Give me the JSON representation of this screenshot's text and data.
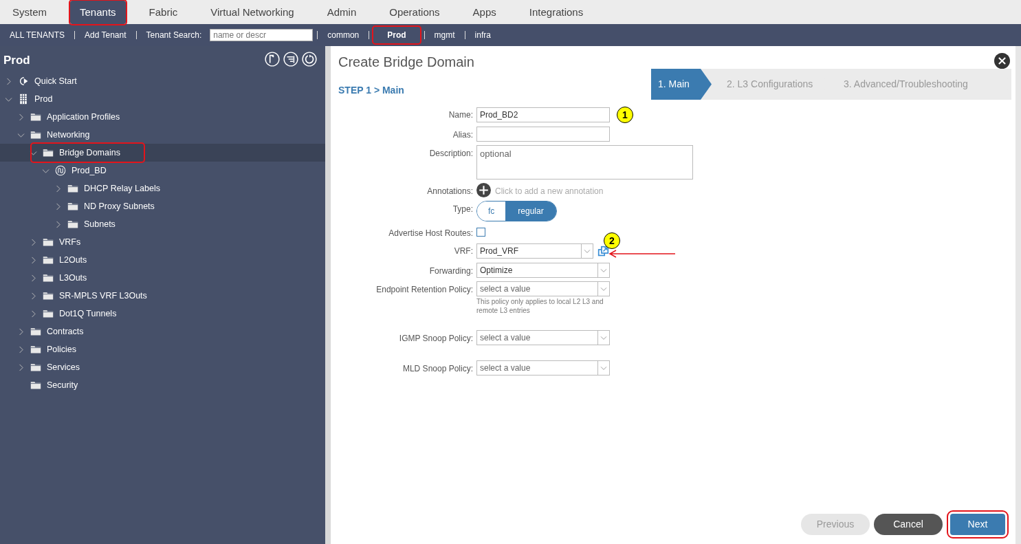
{
  "top_tabs": [
    {
      "label": "System",
      "selected": false,
      "highlighted": false
    },
    {
      "label": "Tenants",
      "selected": true,
      "highlighted": true
    },
    {
      "label": "Fabric",
      "selected": false,
      "highlighted": false
    },
    {
      "label": "Virtual Networking",
      "selected": false,
      "highlighted": false
    },
    {
      "label": "Admin",
      "selected": false,
      "highlighted": false
    },
    {
      "label": "Operations",
      "selected": false,
      "highlighted": false
    },
    {
      "label": "Apps",
      "selected": false,
      "highlighted": false
    },
    {
      "label": "Integrations",
      "selected": false,
      "highlighted": false
    }
  ],
  "tenant_bar": [
    {
      "kind": "link",
      "label": "ALL TENANTS",
      "selected": false,
      "highlighted": false
    },
    {
      "kind": "link",
      "label": "Add Tenant",
      "selected": false,
      "highlighted": false
    },
    {
      "kind": "search",
      "label": "Tenant Search:",
      "placeholder": "name or descr"
    },
    {
      "kind": "link",
      "label": "common",
      "selected": false,
      "highlighted": false
    },
    {
      "kind": "link",
      "label": "Prod",
      "selected": true,
      "highlighted": true
    },
    {
      "kind": "link",
      "label": "mgmt",
      "selected": false,
      "highlighted": false
    },
    {
      "kind": "link",
      "label": "infra",
      "selected": false,
      "highlighted": false
    }
  ],
  "sidebar": {
    "title": "Prod",
    "tree": [
      {
        "label": "Quick Start",
        "kind": "quickstart",
        "expandable": true,
        "expanded": false,
        "selected": false,
        "highlighted": false
      },
      {
        "label": "Prod",
        "kind": "tenant",
        "expandable": true,
        "expanded": true,
        "selected": false,
        "highlighted": false,
        "children": [
          {
            "label": "Application Profiles",
            "kind": "folder",
            "expandable": true,
            "expanded": false,
            "selected": false,
            "highlighted": false
          },
          {
            "label": "Networking",
            "kind": "folder",
            "expandable": true,
            "expanded": true,
            "selected": false,
            "highlighted": false,
            "children": [
              {
                "label": "Bridge Domains",
                "kind": "folder",
                "expandable": true,
                "expanded": true,
                "selected": true,
                "highlighted": true,
                "children": [
                  {
                    "label": "Prod_BD",
                    "kind": "bd",
                    "expandable": true,
                    "expanded": true,
                    "selected": false,
                    "highlighted": false,
                    "children": [
                      {
                        "label": "DHCP Relay Labels",
                        "kind": "folder",
                        "expandable": true,
                        "expanded": false,
                        "selected": false,
                        "highlighted": false
                      },
                      {
                        "label": "ND Proxy Subnets",
                        "kind": "folder",
                        "expandable": true,
                        "expanded": false,
                        "selected": false,
                        "highlighted": false
                      },
                      {
                        "label": "Subnets",
                        "kind": "folder",
                        "expandable": true,
                        "expanded": false,
                        "selected": false,
                        "highlighted": false
                      }
                    ]
                  }
                ]
              },
              {
                "label": "VRFs",
                "kind": "folder",
                "expandable": true,
                "expanded": false,
                "selected": false,
                "highlighted": false
              },
              {
                "label": "L2Outs",
                "kind": "folder",
                "expandable": true,
                "expanded": false,
                "selected": false,
                "highlighted": false
              },
              {
                "label": "L3Outs",
                "kind": "folder",
                "expandable": true,
                "expanded": false,
                "selected": false,
                "highlighted": false
              },
              {
                "label": "SR-MPLS VRF L3Outs",
                "kind": "folder",
                "expandable": true,
                "expanded": false,
                "selected": false,
                "highlighted": false
              },
              {
                "label": "Dot1Q Tunnels",
                "kind": "folder",
                "expandable": true,
                "expanded": false,
                "selected": false,
                "highlighted": false
              }
            ]
          },
          {
            "label": "Contracts",
            "kind": "folder",
            "expandable": true,
            "expanded": false,
            "selected": false,
            "highlighted": false
          },
          {
            "label": "Policies",
            "kind": "folder",
            "expandable": true,
            "expanded": false,
            "selected": false,
            "highlighted": false
          },
          {
            "label": "Services",
            "kind": "folder",
            "expandable": true,
            "expanded": false,
            "selected": false,
            "highlighted": false
          },
          {
            "label": "Security",
            "kind": "folder",
            "expandable": false,
            "selected": false,
            "highlighted": false
          }
        ]
      }
    ]
  },
  "dialog": {
    "title": "Create Bridge Domain",
    "step_label": "STEP 1 > Main",
    "steps": [
      {
        "label": "1. Main",
        "selected": true
      },
      {
        "label": "2. L3 Configurations",
        "selected": false
      },
      {
        "label": "3. Advanced/Troubleshooting",
        "selected": false
      }
    ],
    "fields": [
      {
        "kind": "text",
        "label": "Name:",
        "value": "Prod_BD2",
        "callout": "1"
      },
      {
        "kind": "text",
        "label": "Alias:"
      },
      {
        "kind": "textarea",
        "label": "Description:",
        "placeholder": "optional"
      },
      {
        "kind": "annotations",
        "label": "Annotations:",
        "hint": "Click to add a new annotation"
      },
      {
        "kind": "toggle",
        "label": "Type:",
        "options": [
          {
            "label": "fc",
            "selected": false
          },
          {
            "label": "regular",
            "selected": true
          }
        ]
      },
      {
        "kind": "checkbox",
        "label": "Advertise Host Routes:",
        "checked": false
      },
      {
        "kind": "select",
        "label": "VRF:",
        "value": "Prod_VRF",
        "callout": "2",
        "link": true
      },
      {
        "kind": "select",
        "label": "Forwarding:",
        "value": "Optimize"
      },
      {
        "kind": "select",
        "label": "Endpoint Retention Policy:",
        "placeholder": "select a value",
        "note": "This policy only applies to local L2 L3 and remote L3 entries"
      },
      {
        "kind": "select",
        "label": "IGMP Snoop Policy:",
        "placeholder": "select a value",
        "gap": true
      },
      {
        "kind": "select",
        "label": "MLD Snoop Policy:",
        "placeholder": "select a value",
        "gap": true
      }
    ],
    "buttons": [
      {
        "label": "Previous",
        "kind": "secondary",
        "disabled": true,
        "highlighted": false
      },
      {
        "label": "Cancel",
        "kind": "dark",
        "disabled": false,
        "highlighted": false
      },
      {
        "label": "Next",
        "kind": "primary",
        "disabled": false,
        "highlighted": true
      }
    ]
  }
}
